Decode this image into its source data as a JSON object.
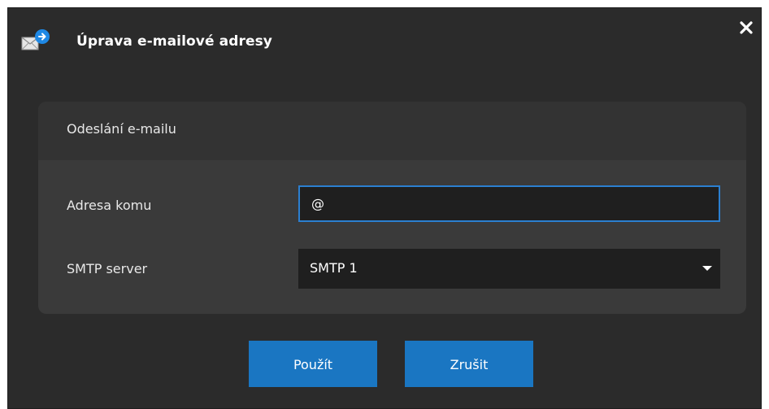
{
  "dialog": {
    "title": "Úprava e-mailové adresy",
    "title_icon": "email-send-icon",
    "close_icon": "close-icon"
  },
  "panel": {
    "title": "Odeslání e-mailu",
    "email_label": "Adresa komu",
    "email_value": "@",
    "smtp_label": "SMTP server",
    "smtp_value": "SMTP 1",
    "dropdown_icon": "chevron-down-icon"
  },
  "buttons": {
    "apply_label": "Použít",
    "cancel_label": "Zrušit"
  },
  "colors": {
    "dialog_bg": "#2b2b2b",
    "panel_bg": "#3a3a3a",
    "input_bg": "#1f1f1f",
    "focus_border": "#2b7fd0",
    "button_bg": "#1a76c2"
  }
}
